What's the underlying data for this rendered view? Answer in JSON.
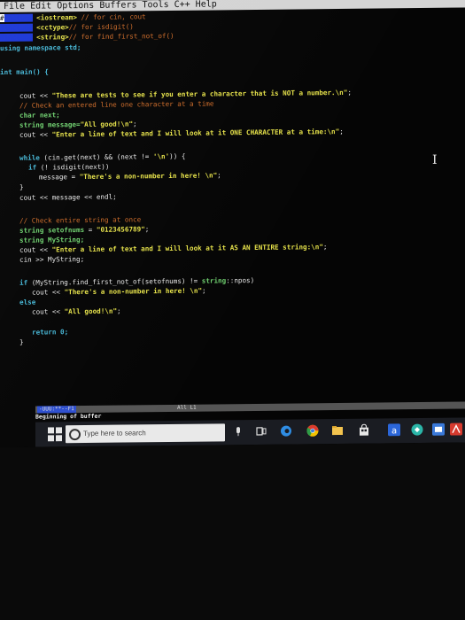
{
  "menu": [
    "File",
    "Edit",
    "Options",
    "Buffers",
    "Tools",
    "C++",
    "Help"
  ],
  "code": {
    "l1_comment": "// for cin, cout",
    "l2_comment": "// for isdigit()",
    "l3_comment": "// for find_first_not_of()",
    "l4": "using namespace std;",
    "l6": "int main() {",
    "l8_str": "\"These are tests to see if you enter a character that is NOT a number.\\n\"",
    "l9": "// Check an entered line one character at a time",
    "l10": "char next;",
    "l11_str": "\"All good!\\n\"",
    "l12_str": "\"Enter a line of text and I will look at it ONE CHARACTER at a time:\\n\"",
    "l14_str": "'\\n'",
    "l16_str": "\"There's a non-number in here! \\n\"",
    "l19": "// Check entire string at once",
    "l20_str": "\"0123456789\"",
    "l21": "string MyString;",
    "l22_str": "\"Enter a line of text and I will look at it AS AN ENTIRE string:\\n\"",
    "l23": "cin >> MyString;",
    "l25_str": "\"There's a non-number in here! \\n\"",
    "l27_str": "\"All good!\\n\"",
    "l28": "return 0;"
  },
  "modeline": "-UUU:**--F1",
  "modeline_mid": "All L1",
  "echo_area": "Beginning of buffer",
  "taskbar": {
    "search_placeholder": "Type here to search"
  }
}
